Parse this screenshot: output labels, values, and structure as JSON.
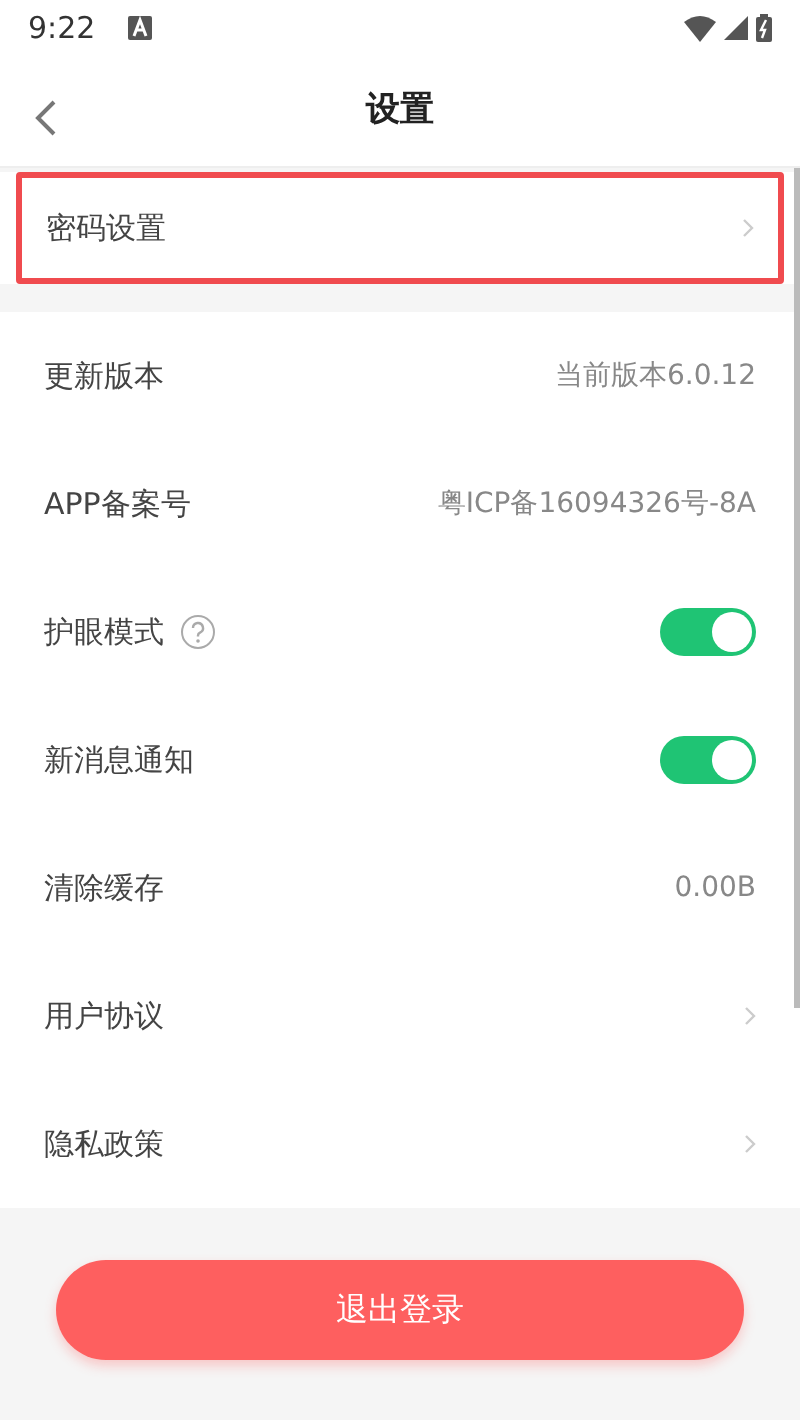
{
  "status_bar": {
    "time": "9:22"
  },
  "header": {
    "title": "设置"
  },
  "top_section": [
    {
      "label": "密码设置",
      "kind": "link",
      "highlighted": true
    }
  ],
  "settings": [
    {
      "label": "更新版本",
      "kind": "value",
      "value": "当前版本6.0.12"
    },
    {
      "label": "APP备案号",
      "kind": "value",
      "value": "粤ICP备16094326号-8A"
    },
    {
      "label": "护眼模式",
      "kind": "toggle",
      "on": true,
      "help": true
    },
    {
      "label": "新消息通知",
      "kind": "toggle",
      "on": true
    },
    {
      "label": "清除缓存",
      "kind": "value",
      "value": "0.00B"
    },
    {
      "label": "用户协议",
      "kind": "link"
    },
    {
      "label": "隐私政策",
      "kind": "link"
    }
  ],
  "logout_button": "退出登录"
}
